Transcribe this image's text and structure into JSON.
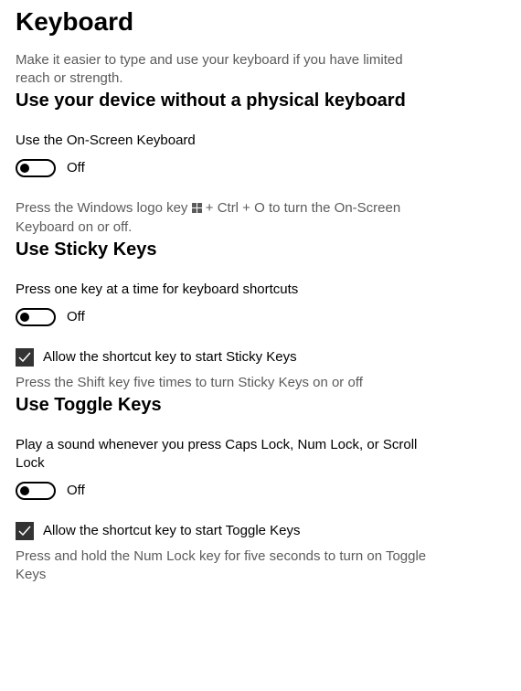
{
  "page": {
    "title": "Keyboard",
    "subtitle": "Make it easier to type and use your keyboard if you have limited reach or strength."
  },
  "section1": {
    "heading": "Use your device without a physical keyboard",
    "toggle_label": "Use the On-Screen Keyboard",
    "toggle_state": "Off",
    "hint_pre": "Press the Windows logo key ",
    "hint_post": " + Ctrl + O to turn the On-Screen Keyboard on or off."
  },
  "section2": {
    "heading": "Use Sticky Keys",
    "toggle_label": "Press one key at a time for keyboard shortcuts",
    "toggle_state": "Off",
    "checkbox_label": "Allow the shortcut key to start Sticky Keys",
    "hint": "Press the Shift key five times to turn Sticky Keys on or off"
  },
  "section3": {
    "heading": "Use Toggle Keys",
    "toggle_label": "Play a sound whenever you press Caps Lock, Num Lock, or Scroll Lock",
    "toggle_state": "Off",
    "checkbox_label": "Allow the shortcut key to start Toggle Keys",
    "hint": "Press and hold the Num Lock key for five seconds to turn on Toggle Keys"
  }
}
